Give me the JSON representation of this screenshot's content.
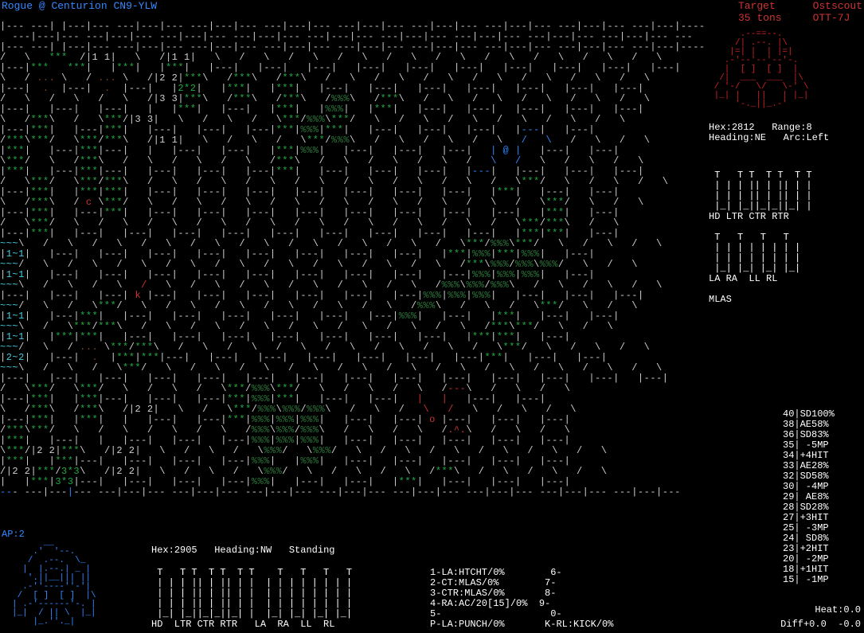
{
  "header": {
    "pilot": "Rogue",
    "sep": "@",
    "mech": "Centurion CN9-YLW",
    "target_label": "Target",
    "target_name": "Ostscout",
    "target_tons": "35 tons",
    "target_variant": "OTT-7J"
  },
  "target": {
    "hex_label": "Hex:",
    "hex": "2812",
    "range_label": "Range:",
    "range": "8",
    "heading_label": "Heading:",
    "heading": "NE",
    "arc_label": "Arc:",
    "arc": "Left",
    "armor_labels_top": "HD LTR CTR RTR",
    "armor_labels_bot": "LA RA  LL RL",
    "weapon": "MLAS"
  },
  "odds": [
    "40|SD100%",
    "38|AE58%",
    "36|SD83%",
    "35| -5MP",
    "34|+4HIT",
    "33|AE28%",
    "32|SD58%",
    "30| -4MP",
    "29| AE8%",
    "28|SD28%",
    "27|+3HIT",
    "25| -3MP",
    "24| SD8%",
    "23|+2HIT",
    "20| -2MP",
    "18|+1HIT",
    "15| -1MP"
  ],
  "bottom": {
    "ap_label": "AP:",
    "ap": "2",
    "hex_label": "Hex:",
    "hex": "2905",
    "heading_label": "Heading:",
    "heading": "NW",
    "stance": "Standing",
    "armor_labels": "HD  LTR CTR RTR   LA  RA  LL  RL",
    "weapons": {
      "w1": "1-LA:HTCHT/0%",
      "w2": "2-CT:MLAS/0%",
      "w3": "3-CTR:MLAS/0%",
      "w4": "4-RA:AC/20[15]/0%",
      "w5": "5-",
      "w6": "6-",
      "w7": "7-",
      "w8": "8-",
      "w9": "9-",
      "w0": "0-",
      "wp": "P-LA:PUNCH/0%",
      "wk": "K-RL:KICK/0%"
    },
    "heat_label": "Heat:",
    "heat": "0.0",
    "diff_label": "Diff",
    "diff": "+0.0  -0.0"
  }
}
